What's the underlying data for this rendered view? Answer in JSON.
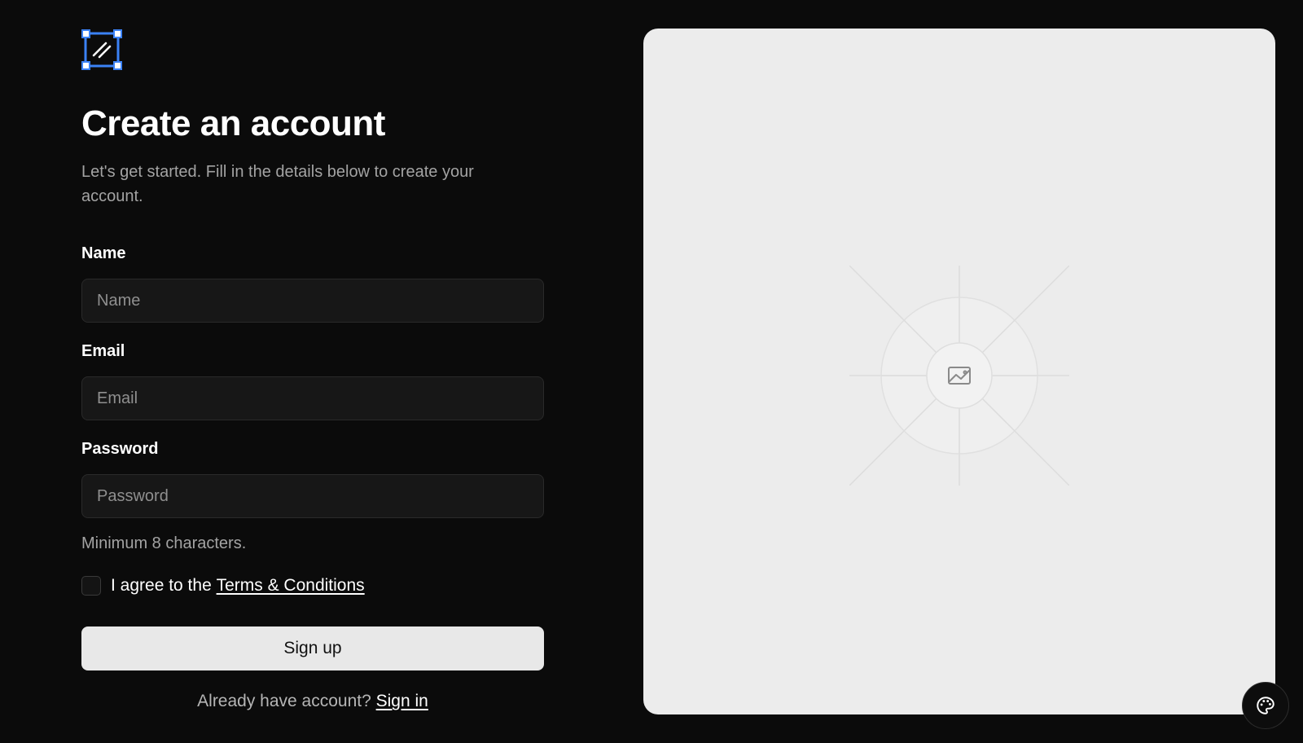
{
  "header": {
    "logo_icon": "selection-box-logo-icon",
    "title": "Create an account",
    "subtitle": "Let's get started. Fill in the details below to create your account."
  },
  "form": {
    "name": {
      "label": "Name",
      "placeholder": "Name",
      "value": ""
    },
    "email": {
      "label": "Email",
      "placeholder": "Email",
      "value": ""
    },
    "password": {
      "label": "Password",
      "placeholder": "Password",
      "value": "",
      "hint": "Minimum 8 characters."
    },
    "terms": {
      "checked": false,
      "prefix": "I agree to the ",
      "link_text": "Terms & Conditions"
    },
    "submit_label": "Sign up"
  },
  "footer": {
    "prompt": "Already have account? ",
    "link_text": "Sign in"
  },
  "image_panel": {
    "icon": "image-placeholder-icon"
  },
  "theme_button": {
    "icon": "palette-icon"
  },
  "colors": {
    "background": "#0b0b0b",
    "accent_logo": "#3b82f6",
    "panel": "#ececec",
    "button": "#e8e8e8",
    "input_bg": "#171717"
  }
}
